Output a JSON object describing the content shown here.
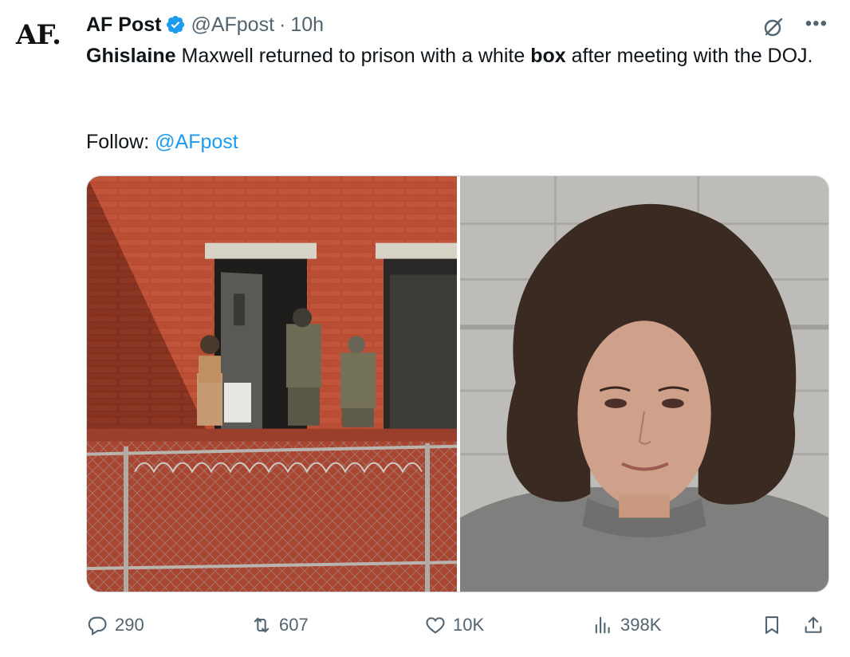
{
  "author": {
    "avatar_text": "AF.",
    "name": "AF Post",
    "handle": "@AFpost",
    "separator": "·",
    "time": "10h"
  },
  "tweet": {
    "segments": [
      {
        "text": "Ghislaine",
        "bold": true
      },
      {
        "text": " Maxwell returned to prison with a white ",
        "bold": false
      },
      {
        "text": "box",
        "bold": true
      },
      {
        "text": " after meeting with the DOJ.",
        "bold": false
      }
    ],
    "follow_label": "Follow: ",
    "follow_mention": "@AFpost"
  },
  "actions": {
    "replies": "290",
    "reposts": "607",
    "likes": "10K",
    "views": "398K"
  },
  "icons": {
    "verified": "verified-badge-icon",
    "grok": "grok-icon",
    "more": "more-icon",
    "reply": "reply-icon",
    "repost": "repost-icon",
    "like": "heart-icon",
    "views": "views-bar-chart-icon",
    "bookmark": "bookmark-icon",
    "share": "share-icon"
  },
  "colors": {
    "accent": "#1d9bf0",
    "text_secondary": "#536471",
    "text_primary": "#0f1419"
  }
}
